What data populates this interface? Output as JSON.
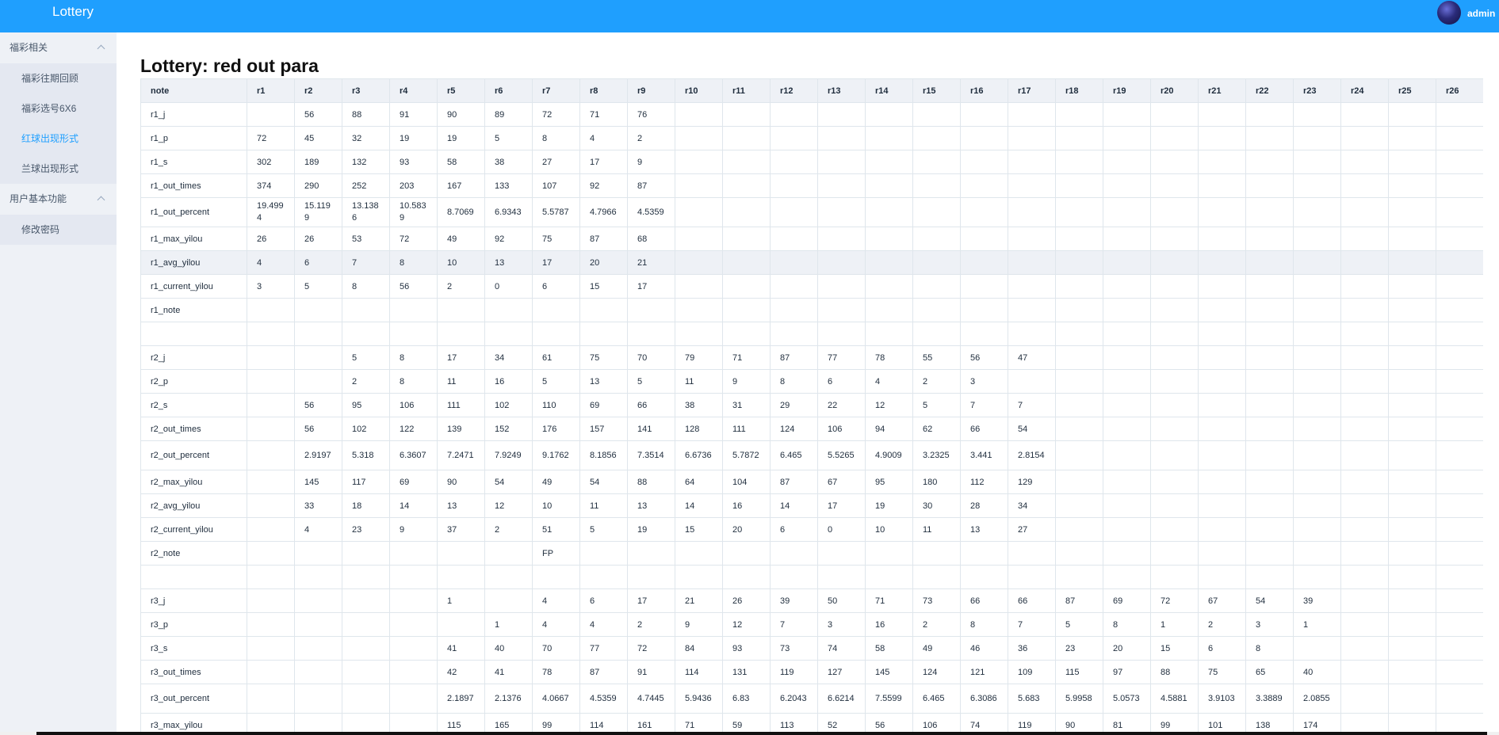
{
  "header": {
    "title": "Lottery",
    "user": "admin"
  },
  "sidebar": {
    "groups": [
      {
        "title": "福彩相关",
        "items": [
          "福彩往期回顾",
          "福彩选号6X6",
          "红球出现形式",
          "兰球出现形式"
        ]
      },
      {
        "title": "用户基本功能",
        "items": [
          "修改密码"
        ]
      }
    ]
  },
  "page": {
    "title": "Lottery: red out para"
  },
  "table": {
    "columns": [
      "note",
      "r1",
      "r2",
      "r3",
      "r4",
      "r5",
      "r6",
      "r7",
      "r8",
      "r9",
      "r10",
      "r11",
      "r12",
      "r13",
      "r14",
      "r15",
      "r16",
      "r17",
      "r18",
      "r19",
      "r20",
      "r21",
      "r22",
      "r23",
      "r24",
      "r25",
      "r26"
    ],
    "rows": [
      [
        "r1_j",
        "",
        "56",
        "88",
        "91",
        "90",
        "89",
        "72",
        "71",
        "76",
        "",
        "",
        "",
        "",
        "",
        "",
        "",
        "",
        "",
        "",
        "",
        "",
        "",
        "",
        "",
        "",
        ""
      ],
      [
        "r1_p",
        "72",
        "45",
        "32",
        "19",
        "19",
        "5",
        "8",
        "4",
        "2",
        "",
        "",
        "",
        "",
        "",
        "",
        "",
        "",
        "",
        "",
        "",
        "",
        "",
        "",
        "",
        "",
        ""
      ],
      [
        "r1_s",
        "302",
        "189",
        "132",
        "93",
        "58",
        "38",
        "27",
        "17",
        "9",
        "",
        "",
        "",
        "",
        "",
        "",
        "",
        "",
        "",
        "",
        "",
        "",
        "",
        "",
        "",
        "",
        ""
      ],
      [
        "r1_out_times",
        "374",
        "290",
        "252",
        "203",
        "167",
        "133",
        "107",
        "92",
        "87",
        "",
        "",
        "",
        "",
        "",
        "",
        "",
        "",
        "",
        "",
        "",
        "",
        "",
        "",
        "",
        "",
        ""
      ],
      [
        "r1_out_percent",
        "19.4994",
        "15.1199",
        "13.1386",
        "10.5839",
        "8.7069",
        "6.9343",
        "5.5787",
        "4.7966",
        "4.5359",
        "",
        "",
        "",
        "",
        "",
        "",
        "",
        "",
        "",
        "",
        "",
        "",
        "",
        "",
        "",
        "",
        ""
      ],
      [
        "r1_max_yilou",
        "26",
        "26",
        "53",
        "72",
        "49",
        "92",
        "75",
        "87",
        "68",
        "",
        "",
        "",
        "",
        "",
        "",
        "",
        "",
        "",
        "",
        "",
        "",
        "",
        "",
        "",
        "",
        ""
      ],
      [
        "r1_avg_yilou",
        "4",
        "6",
        "7",
        "8",
        "10",
        "13",
        "17",
        "20",
        "21",
        "",
        "",
        "",
        "",
        "",
        "",
        "",
        "",
        "",
        "",
        "",
        "",
        "",
        "",
        "",
        "",
        ""
      ],
      [
        "r1_current_yilou",
        "3",
        "5",
        "8",
        "56",
        "2",
        "0",
        "6",
        "15",
        "17",
        "",
        "",
        "",
        "",
        "",
        "",
        "",
        "",
        "",
        "",
        "",
        "",
        "",
        "",
        "",
        "",
        ""
      ],
      [
        "r1_note",
        "",
        "",
        "",
        "",
        "",
        "",
        "",
        "",
        "",
        "",
        "",
        "",
        "",
        "",
        "",
        "",
        "",
        "",
        "",
        "",
        "",
        "",
        "",
        "",
        "",
        ""
      ],
      [
        "",
        "",
        "",
        "",
        "",
        "",
        "",
        "",
        "",
        "",
        "",
        "",
        "",
        "",
        "",
        "",
        "",
        "",
        "",
        "",
        "",
        "",
        "",
        "",
        "",
        "",
        ""
      ],
      [
        "r2_j",
        "",
        "",
        "5",
        "8",
        "17",
        "34",
        "61",
        "75",
        "70",
        "79",
        "71",
        "87",
        "77",
        "78",
        "55",
        "56",
        "47",
        "",
        "",
        "",
        "",
        "",
        "",
        "",
        "",
        ""
      ],
      [
        "r2_p",
        "",
        "",
        "2",
        "8",
        "11",
        "16",
        "5",
        "13",
        "5",
        "11",
        "9",
        "8",
        "6",
        "4",
        "2",
        "3",
        "",
        "",
        "",
        "",
        "",
        "",
        "",
        "",
        "",
        ""
      ],
      [
        "r2_s",
        "",
        "56",
        "95",
        "106",
        "111",
        "102",
        "110",
        "69",
        "66",
        "38",
        "31",
        "29",
        "22",
        "12",
        "5",
        "7",
        "7",
        "",
        "",
        "",
        "",
        "",
        "",
        "",
        "",
        ""
      ],
      [
        "r2_out_times",
        "",
        "56",
        "102",
        "122",
        "139",
        "152",
        "176",
        "157",
        "141",
        "128",
        "111",
        "124",
        "106",
        "94",
        "62",
        "66",
        "54",
        "",
        "",
        "",
        "",
        "",
        "",
        "",
        "",
        ""
      ],
      [
        "r2_out_percent",
        "",
        "2.9197",
        "5.318",
        "6.3607",
        "7.2471",
        "7.9249",
        "9.1762",
        "8.1856",
        "7.3514",
        "6.6736",
        "5.7872",
        "6.465",
        "5.5265",
        "4.9009",
        "3.2325",
        "3.441",
        "2.8154",
        "",
        "",
        "",
        "",
        "",
        "",
        "",
        "",
        ""
      ],
      [
        "r2_max_yilou",
        "",
        "145",
        "117",
        "69",
        "90",
        "54",
        "49",
        "54",
        "88",
        "64",
        "104",
        "87",
        "67",
        "95",
        "180",
        "112",
        "129",
        "",
        "",
        "",
        "",
        "",
        "",
        "",
        "",
        ""
      ],
      [
        "r2_avg_yilou",
        "",
        "33",
        "18",
        "14",
        "13",
        "12",
        "10",
        "11",
        "13",
        "14",
        "16",
        "14",
        "17",
        "19",
        "30",
        "28",
        "34",
        "",
        "",
        "",
        "",
        "",
        "",
        "",
        "",
        ""
      ],
      [
        "r2_current_yilou",
        "",
        "4",
        "23",
        "9",
        "37",
        "2",
        "51",
        "5",
        "19",
        "15",
        "20",
        "6",
        "0",
        "10",
        "11",
        "13",
        "27",
        "",
        "",
        "",
        "",
        "",
        "",
        "",
        "",
        ""
      ],
      [
        "r2_note",
        "",
        "",
        "",
        "",
        "",
        "",
        "FP",
        "",
        "",
        "",
        "",
        "",
        "",
        "",
        "",
        "",
        "",
        "",
        "",
        "",
        "",
        "",
        "",
        "",
        "",
        ""
      ],
      [
        "",
        "",
        "",
        "",
        "",
        "",
        "",
        "",
        "",
        "",
        "",
        "",
        "",
        "",
        "",
        "",
        "",
        "",
        "",
        "",
        "",
        "",
        "",
        "",
        "",
        "",
        ""
      ],
      [
        "r3_j",
        "",
        "",
        "",
        "",
        "1",
        "",
        "4",
        "6",
        "17",
        "21",
        "26",
        "39",
        "50",
        "71",
        "73",
        "66",
        "66",
        "87",
        "69",
        "72",
        "67",
        "54",
        "39",
        "",
        "",
        ""
      ],
      [
        "r3_p",
        "",
        "",
        "",
        "",
        "",
        "1",
        "4",
        "4",
        "2",
        "9",
        "12",
        "7",
        "3",
        "16",
        "2",
        "8",
        "7",
        "5",
        "8",
        "1",
        "2",
        "3",
        "1",
        "",
        "",
        ""
      ],
      [
        "r3_s",
        "",
        "",
        "",
        "",
        "41",
        "40",
        "70",
        "77",
        "72",
        "84",
        "93",
        "73",
        "74",
        "58",
        "49",
        "46",
        "36",
        "23",
        "20",
        "15",
        "6",
        "8",
        "",
        "",
        "",
        ""
      ],
      [
        "r3_out_times",
        "",
        "",
        "",
        "",
        "42",
        "41",
        "78",
        "87",
        "91",
        "114",
        "131",
        "119",
        "127",
        "145",
        "124",
        "121",
        "109",
        "115",
        "97",
        "88",
        "75",
        "65",
        "40",
        "",
        "",
        ""
      ],
      [
        "r3_out_percent",
        "",
        "",
        "",
        "",
        "2.1897",
        "2.1376",
        "4.0667",
        "4.5359",
        "4.7445",
        "5.9436",
        "6.83",
        "6.2043",
        "6.6214",
        "7.5599",
        "6.465",
        "6.3086",
        "5.683",
        "5.9958",
        "5.0573",
        "4.5881",
        "3.9103",
        "3.3889",
        "2.0855",
        "",
        "",
        ""
      ],
      [
        "r3_max_yilou",
        "",
        "",
        "",
        "",
        "115",
        "165",
        "99",
        "114",
        "161",
        "71",
        "59",
        "113",
        "52",
        "56",
        "106",
        "74",
        "119",
        "90",
        "81",
        "99",
        "101",
        "138",
        "174",
        "",
        "",
        ""
      ]
    ]
  }
}
